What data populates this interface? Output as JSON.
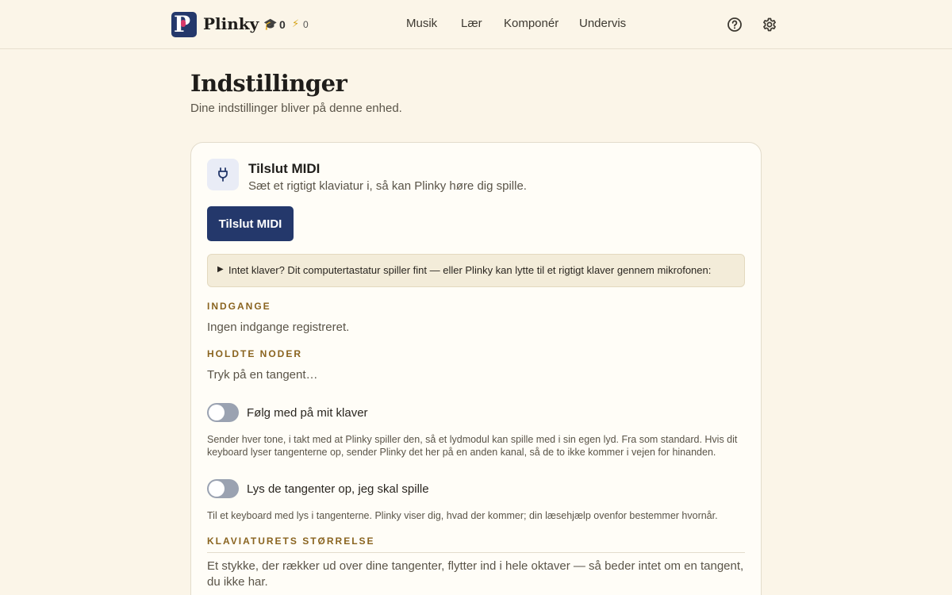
{
  "app": {
    "brand": "Plinky",
    "logo_letter": "P",
    "stats": {
      "caps": "0",
      "energy": "0"
    }
  },
  "nav": {
    "items": [
      "Musik",
      "Lær",
      "Komponér",
      "Undervis"
    ]
  },
  "header_icons": [
    "help-icon",
    "gear-icon"
  ],
  "page": {
    "title": "Indstillinger",
    "subtitle": "Dine indstillinger bliver på denne enhed."
  },
  "midi_card": {
    "title": "Tilslut MIDI",
    "subtitle": "Sæt et rigtigt klaviatur i, så kan Plinky høre dig spille.",
    "connect_button": "Tilslut MIDI",
    "details_summary": "Intet klaver? Dit computertastatur spiller fint — eller Plinky kan lytte til et rigtigt klaver gennem mikrofonen:",
    "inputs_label": "INDGANGE",
    "inputs_value": "Ingen indgange registreret.",
    "held_label": "HOLDTE NODER",
    "held_value": "Tryk på en tangent…",
    "follow_toggle": {
      "label": "Følg med på mit klaver",
      "on": false,
      "help": "Sender hver tone, i takt med at Plinky spiller den, så et lydmodul kan spille med i sin egen lyd. Fra som standard. Hvis dit keyboard lyser tangenterne op, sender Plinky det her på en anden kanal, så de to ikke kommer i vejen for hinanden."
    },
    "light_toggle": {
      "label": "Lys de tangenter op, jeg skal spille",
      "on": false,
      "help": "Til et keyboard med lys i tangenterne. Plinky viser dig, hvad der kommer; din læsehjælp ovenfor bestemmer hvornår."
    },
    "size_label": "KLAVIATURETS STØRRELSE",
    "size_text": "Et stykke, der rækker ud over dine tangenter, flytter ind i hele oktaver — så beder intet om en tangent, du ikke har."
  },
  "colors": {
    "background": "#fbf5e8",
    "accent": "#24386b",
    "section_label": "#8a6420",
    "toggle_off": "#9aa2b1",
    "logo_dot": "#d83a6b"
  }
}
